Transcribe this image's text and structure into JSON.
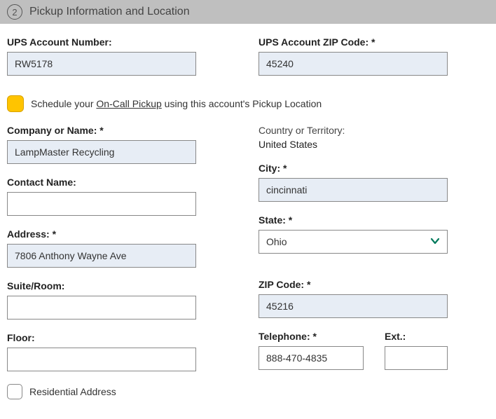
{
  "header": {
    "step_number": "2",
    "title": "Pickup Information and Location"
  },
  "left": {
    "ups_account_label": "UPS Account Number:",
    "ups_account_value": "RW5178",
    "company_label": "Company or Name: *",
    "company_value": "LampMaster Recycling",
    "contact_label": "Contact Name:",
    "contact_value": "",
    "address_label": "Address: *",
    "address_value": "7806 Anthony Wayne Ave",
    "suite_label": "Suite/Room:",
    "suite_value": "",
    "floor_label": "Floor:",
    "floor_value": "",
    "residential_label": "Residential Address"
  },
  "right": {
    "zip_label": "UPS Account ZIP Code: *",
    "zip_value": "45240",
    "country_label": "Country or Territory:",
    "country_value": "United States",
    "city_label": "City: *",
    "city_value": "cincinnati",
    "state_label": "State: *",
    "state_value": "Ohio",
    "zip2_label": "ZIP Code: *",
    "zip2_value": "45216",
    "phone_label": "Telephone: *",
    "phone_value": "888-470-4835",
    "ext_label": "Ext.:",
    "ext_value": ""
  },
  "on_call": {
    "prefix": "Schedule your ",
    "link": "On-Call Pickup",
    "suffix": " using this account's Pickup Location"
  }
}
